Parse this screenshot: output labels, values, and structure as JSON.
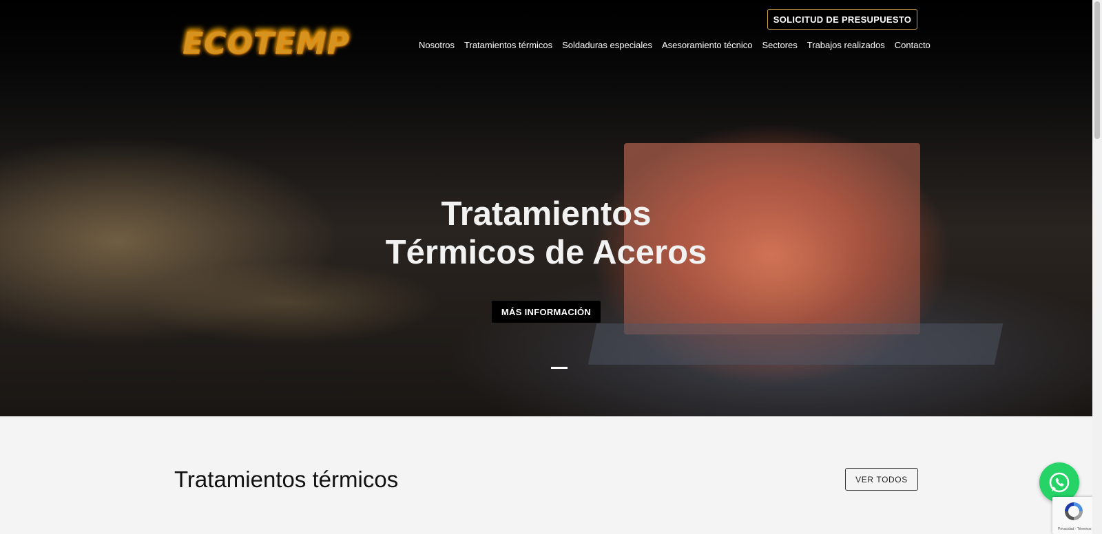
{
  "header": {
    "logo_text": "ECOTEMP",
    "quote_button": "SOLICITUD DE PRESUPUESTO",
    "nav": [
      {
        "label": "Nosotros"
      },
      {
        "label": "Tratamientos térmicos"
      },
      {
        "label": "Soldaduras especiales"
      },
      {
        "label": "Asesoramiento técnico"
      },
      {
        "label": "Sectores"
      },
      {
        "label": "Trabajos realizados"
      },
      {
        "label": "Contacto"
      }
    ]
  },
  "hero": {
    "title_line1": "Tratamientos",
    "title_line2": "Térmicos de Aceros",
    "button": "MÁS INFORMACIÓN"
  },
  "section": {
    "title": "Tratamientos térmicos",
    "view_all": "VER TODOS"
  },
  "recaptcha": {
    "links": "Privacidad - Términos"
  },
  "icons": {
    "whatsapp": "whatsapp-icon",
    "recaptcha": "recaptcha-icon"
  },
  "colors": {
    "quote_border": "#d0a24a",
    "whatsapp_green": "#25d366"
  }
}
